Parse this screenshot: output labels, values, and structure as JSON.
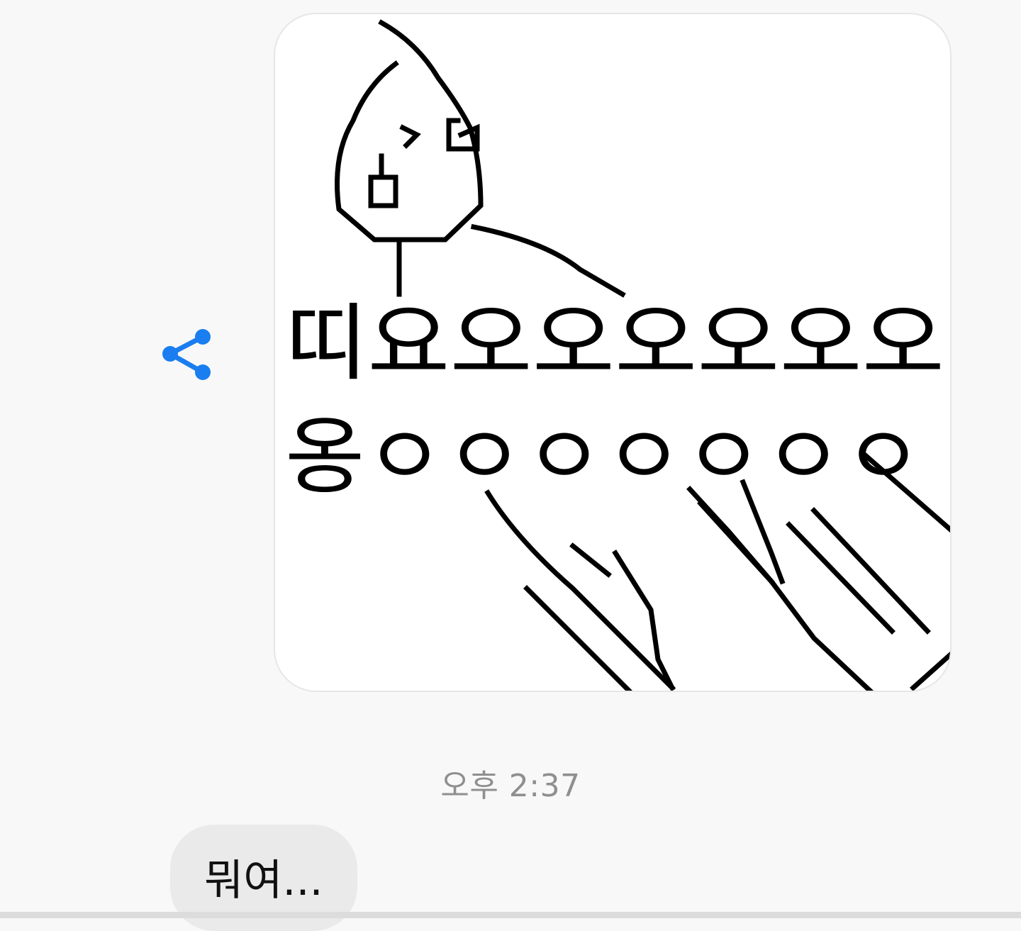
{
  "conversation": {
    "outgoing_image": {
      "text_line_1": "띠요오오오오오오",
      "text_line_2": "옹ㅇㅇㅇㅇㅇㅇㅇ"
    },
    "share_icon": "share-icon",
    "timestamp": "오후 2:37",
    "incoming_message": "뭐여..."
  },
  "colors": {
    "background": "#f8f8f8",
    "accent": "#1a7df0",
    "incoming_bubble": "#eaeaea",
    "timestamp": "#8f8f8f"
  }
}
